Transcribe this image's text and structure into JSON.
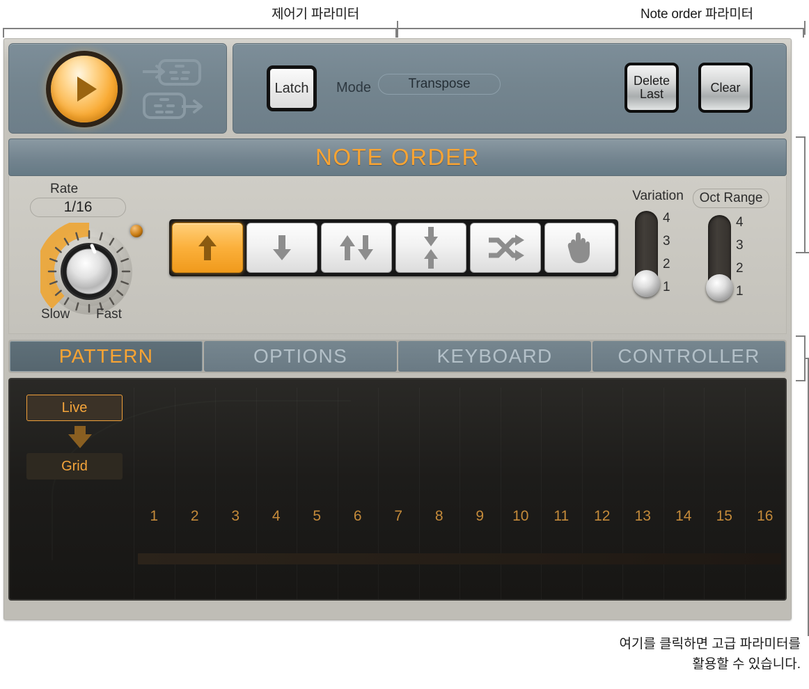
{
  "callouts": {
    "control_params": "제어기 파라미터",
    "note_order_params": "Note order 파라미터",
    "bottom_line1": "여기를 클릭하면 고급 파라미터를",
    "bottom_line2": "활용할 수 있습니다."
  },
  "transport": {
    "play_icon": "play-icon",
    "midi_in_icon": "midi-in-icon",
    "midi_out_icon": "midi-out-icon"
  },
  "note_order_controls": {
    "latch_label": "Latch",
    "mode_label": "Mode",
    "mode_value": "Transpose",
    "delete_last_label": "Delete\nLast",
    "delete_last_line1": "Delete",
    "delete_last_line2": "Last",
    "clear_label": "Clear"
  },
  "note_order": {
    "header": "NOTE ORDER",
    "rate_label": "Rate",
    "rate_value": "1/16",
    "slow_label": "Slow",
    "fast_label": "Fast",
    "directions": [
      {
        "name": "up",
        "icon": "arrow-up-icon",
        "active": true
      },
      {
        "name": "down",
        "icon": "arrow-down-icon",
        "active": false
      },
      {
        "name": "up-down",
        "icon": "arrow-up-down-icon",
        "active": false
      },
      {
        "name": "outside-in",
        "icon": "arrow-inward-icon",
        "active": false
      },
      {
        "name": "random",
        "icon": "shuffle-icon",
        "active": false
      },
      {
        "name": "as-played",
        "icon": "hand-icon",
        "active": false
      }
    ],
    "variation": {
      "label": "Variation",
      "ticks": [
        "4",
        "3",
        "2",
        "1"
      ],
      "value": "1"
    },
    "oct_range": {
      "label": "Oct Range",
      "ticks": [
        "4",
        "3",
        "2",
        "1"
      ],
      "value": "1"
    }
  },
  "tabs": [
    {
      "label": "PATTERN",
      "active": true
    },
    {
      "label": "OPTIONS",
      "active": false
    },
    {
      "label": "KEYBOARD",
      "active": false
    },
    {
      "label": "CONTROLLER",
      "active": false
    }
  ],
  "pattern": {
    "live_label": "Live",
    "grid_label": "Grid",
    "flow_icon": "arrow-down-icon",
    "steps": [
      "1",
      "2",
      "3",
      "4",
      "5",
      "6",
      "7",
      "8",
      "9",
      "10",
      "11",
      "12",
      "13",
      "14",
      "15",
      "16"
    ]
  },
  "colors": {
    "accent_orange": "#f9a433",
    "panel_blue": "#74858f",
    "body_gray": "#c4c2bb",
    "dark_panel": "#1d1c1a"
  }
}
